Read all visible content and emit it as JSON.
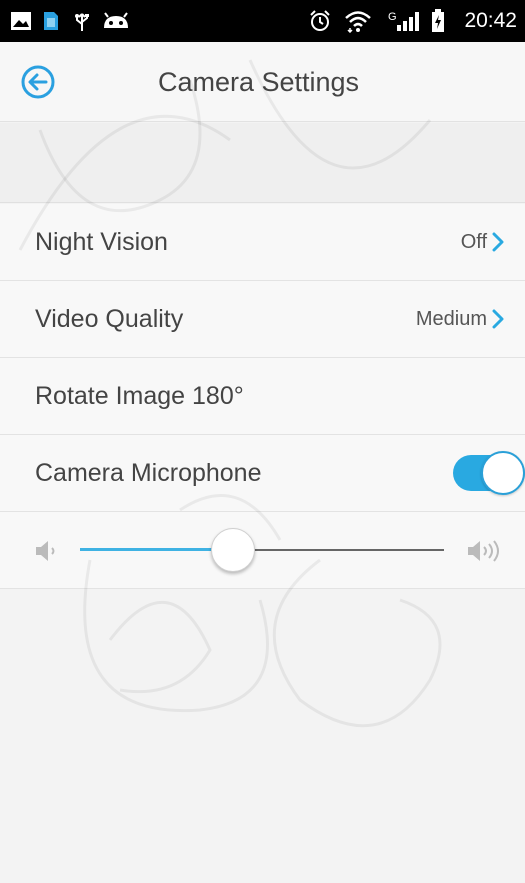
{
  "status_bar": {
    "time": "20:42",
    "icons": [
      "gallery-icon",
      "sim-card-icon",
      "usb-icon",
      "android-icon",
      "alarm-icon",
      "wifi-icon",
      "signal-icon",
      "battery-icon"
    ],
    "network_type": "G"
  },
  "header": {
    "title": "Camera Settings",
    "back_icon": "back-arrow-icon"
  },
  "settings": {
    "night_vision": {
      "label": "Night Vision",
      "value": "Off"
    },
    "video_quality": {
      "label": "Video Quality",
      "value": "Medium"
    },
    "rotate_image": {
      "label": "Rotate Image 180°"
    },
    "camera_microphone": {
      "label": "Camera Microphone",
      "enabled": true
    },
    "microphone_volume": {
      "level": 0.42,
      "low_icon": "volume-low-icon",
      "high_icon": "volume-high-icon"
    }
  },
  "colors": {
    "accent": "#29a9e1",
    "status_bar": "#000000",
    "text": "#444444"
  }
}
